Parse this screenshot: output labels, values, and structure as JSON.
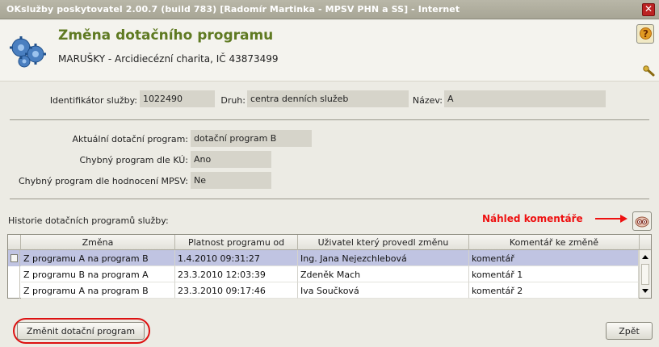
{
  "window": {
    "title": "OKslužby poskytovatel 2.00.7 (build 783)  [Radomír Martinka - MPSV PHN a SS] - Internet",
    "close_symbol": "✕"
  },
  "header": {
    "title": "Změna dotačního programu",
    "subtitle": "MARUŠKY - Arcidiecézní charita, IČ 43873499",
    "help_symbol": "?"
  },
  "service": {
    "id_label": "Identifikátor služby:",
    "id_value": "1022490",
    "type_label": "Druh:",
    "type_value": "centra denních služeb",
    "name_label": "Název:",
    "name_value": "A"
  },
  "program": {
    "current_label": "Aktuální dotační program:",
    "current_value": "dotační program B",
    "error_ku_label": "Chybný program dle KÚ:",
    "error_ku_value": "Ano",
    "error_mpsv_label": "Chybný program dle hodnocení MPSV:",
    "error_mpsv_value": "Ne"
  },
  "history": {
    "label": "Historie dotačních programů služby:",
    "preview_label": "Náhled komentáře",
    "columns": [
      "Změna",
      "Platnost programu od",
      "Uživatel který provedl změnu",
      "Komentář ke změně"
    ],
    "rows": [
      [
        "Z programu A na program B",
        "1.4.2010 09:31:27",
        "Ing. Jana Nejezchlebová",
        "komentář"
      ],
      [
        "Z programu B na program A",
        "23.3.2010 12:03:39",
        "Zdeněk Mach",
        "komentář 1"
      ],
      [
        "Z programu A na program B",
        "23.3.2010 09:17:46",
        "Iva Součková",
        "komentář 2"
      ]
    ],
    "selected_row": 0
  },
  "buttons": {
    "change": "Změnit dotační program",
    "back": "Zpět"
  },
  "colors": {
    "title_green": "#5f7a22",
    "annotation_red": "#e11111",
    "selected_row": "#c0c4e2"
  },
  "icons": [
    "gears-icon",
    "help-icon",
    "wrench-icon",
    "comment-preview-icon",
    "close-icon"
  ]
}
